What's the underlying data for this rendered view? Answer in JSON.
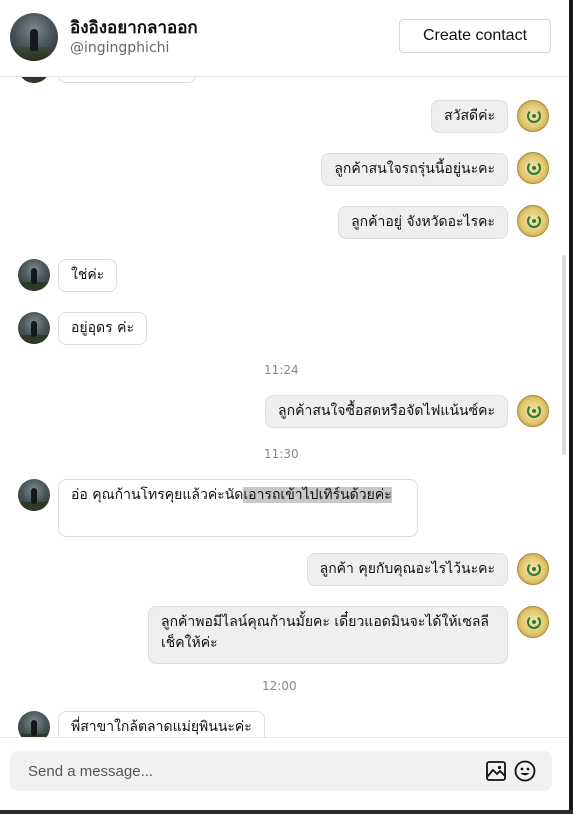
{
  "header": {
    "name": "อิงอิงอยากลาออก",
    "handle": "@ingingphichi",
    "create_contact_label": "Create contact"
  },
  "messages": [
    {
      "dir": "out",
      "text": "สวัสดีค่ะ"
    },
    {
      "dir": "out",
      "text": "ลูกค้าสนใจรถรุ่นนี้อยู่นะคะ"
    },
    {
      "dir": "out",
      "text": "ลูกค้าอยู่ จังหวัดอะไรคะ"
    },
    {
      "dir": "in",
      "text": "ใช่ค่ะ"
    },
    {
      "dir": "in",
      "text": "อยู่อุดร ค่ะ"
    },
    {
      "timestamp": "11:24"
    },
    {
      "dir": "out",
      "text": "ลูกค้าสนใจซื้อสดหรือจัดไฟแน้นซ์คะ"
    },
    {
      "timestamp": "11:30"
    },
    {
      "dir": "in",
      "text_plain": "อ่อ คุณก้านโทรคุยแล้วค่ะนัด",
      "text_highlight": "เอารถเข้าไปเทิร์นด้วยค่ะ"
    },
    {
      "dir": "out",
      "text": "ลูกค้า คุยกับคุณอะไรไว้นะคะ"
    },
    {
      "dir": "out",
      "text": "ลูกค้าพอมีไลน์คุณก้านมั้ยคะ เดี๋ยวแอดมินจะได้ให้เซลลี เช็คให้ค่ะ"
    },
    {
      "timestamp": "12:00"
    },
    {
      "dir": "in",
      "text": "พี่สาขาใกล้ตลาดแม่ยุพินนะค่ะ"
    }
  ],
  "composer": {
    "placeholder": "Send a message..."
  },
  "icons": {
    "image": "image-icon",
    "emoji": "emoji-icon"
  }
}
